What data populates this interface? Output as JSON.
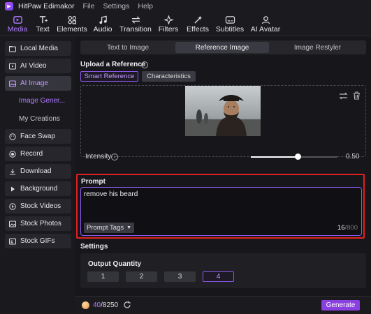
{
  "app": {
    "title": "HitPaw Edimakor",
    "menu": [
      "File",
      "Settings",
      "Help"
    ]
  },
  "toolbar": {
    "items": [
      "Media",
      "Text",
      "Elements",
      "Audio",
      "Transition",
      "Filters",
      "Effects",
      "Subtitles",
      "AI Avatar"
    ],
    "active": "Media"
  },
  "sidebar": {
    "items": [
      "Local Media",
      "AI Video",
      "AI Image",
      "Face Swap",
      "Record",
      "Download",
      "Background",
      "Stock Videos",
      "Stock Photos",
      "Stock GIFs"
    ],
    "sub_items": [
      "Image Gener...",
      "My Creations"
    ],
    "active": "AI Image"
  },
  "tabs": [
    "Text to Image",
    "Reference Image",
    "Image Restyler"
  ],
  "active_tab": "Reference Image",
  "upload": {
    "title": "Upload a Reference",
    "options": [
      "Smart Reference",
      "Characteristics"
    ],
    "selected": "Smart Reference"
  },
  "intensity": {
    "label": "Intensity",
    "value": "0.50",
    "level": 0.5
  },
  "prompt": {
    "title": "Prompt",
    "text": "remove his beard",
    "tags_label": "Prompt Tags",
    "count": "16",
    "max": "/800"
  },
  "settings": {
    "title": "Settings",
    "output_title": "Output Quantity",
    "options": [
      "1",
      "2",
      "3",
      "4"
    ],
    "selected": "4"
  },
  "footer": {
    "credits_used": "40",
    "credits_total": "/8250",
    "generate_label": "Generate"
  },
  "colors": {
    "accent": "#8a3fe0",
    "highlight": "#e02020",
    "background": "#17171b"
  }
}
